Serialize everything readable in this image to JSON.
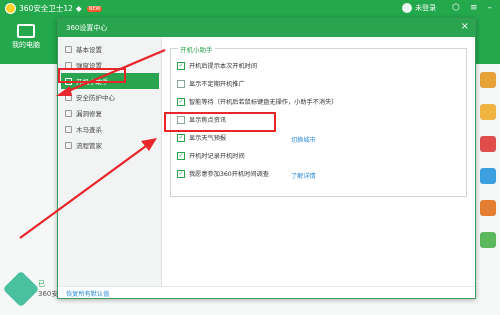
{
  "app": {
    "title": "360安全卫士12",
    "new_badge": "NEW",
    "user_label": "未登录",
    "my_pc_label": "我的电脑",
    "bottom_left_status": "已",
    "bottom_left_label": "360安全大脑"
  },
  "dialog": {
    "title": "360设置中心",
    "close_glyph": "×",
    "footer_link": "恢复所有默认值"
  },
  "nav": {
    "items": [
      {
        "label": "基本设置",
        "active": false
      },
      {
        "label": "弹窗设置",
        "active": false
      },
      {
        "label": "开机小助手",
        "active": true
      },
      {
        "label": "安全防护中心",
        "active": false
      },
      {
        "label": "漏洞修复",
        "active": false
      },
      {
        "label": "木马查杀",
        "active": false
      },
      {
        "label": "流程管家",
        "active": false
      }
    ]
  },
  "section": {
    "title": "开机小助手",
    "options": [
      {
        "label": "开机后提示本次开机时间",
        "checked": true
      },
      {
        "label": "显示不定期开机推广",
        "checked": false
      },
      {
        "label": "智能等待（开机后若鼠标键盘无操作，小助手不消失）",
        "checked": true
      },
      {
        "label": "显示焦点资讯",
        "checked": false
      },
      {
        "label": "显示天气预报",
        "checked": true,
        "link": "切换城市"
      },
      {
        "label": "开机时记录开机时间",
        "checked": true
      },
      {
        "label": "我愿意参加360开机时间调查",
        "checked": true,
        "link": "了解详情"
      }
    ]
  },
  "colors": {
    "brand_green": "#2ba44f",
    "annotation_red": "#e8262b",
    "link_blue": "#2a8ad8"
  }
}
